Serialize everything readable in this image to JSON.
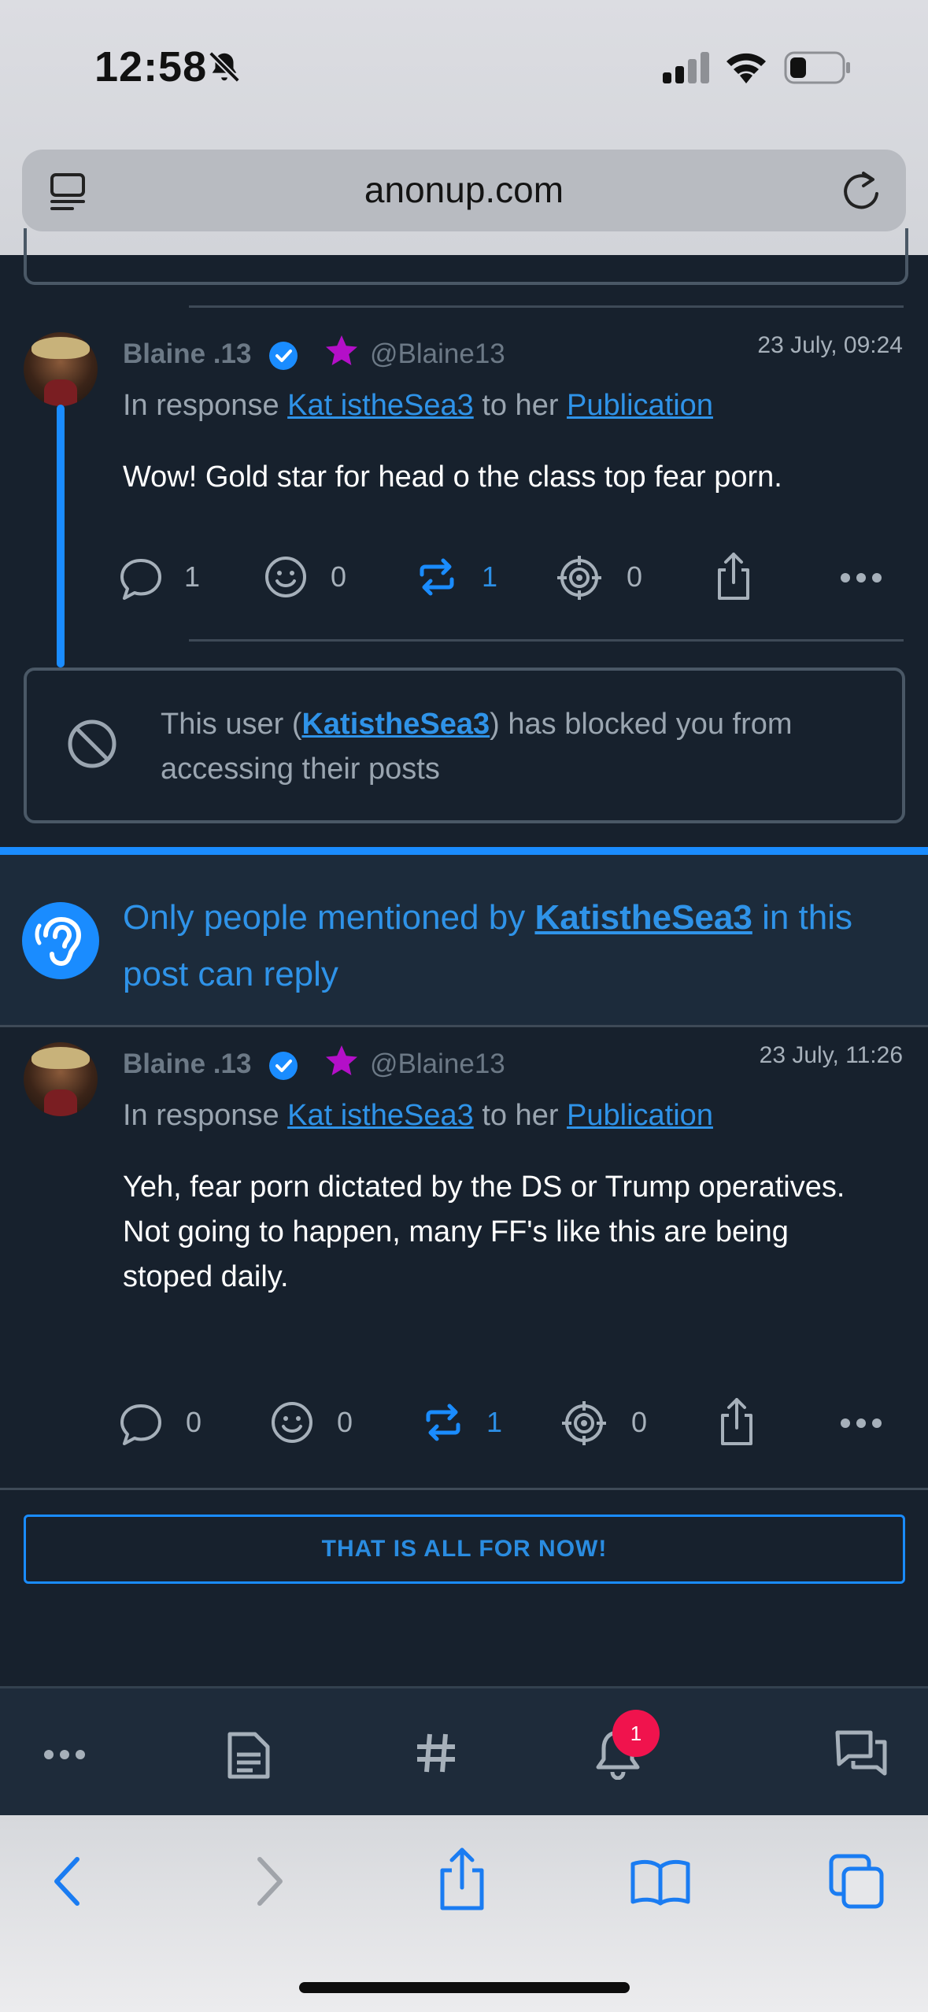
{
  "status_bar": {
    "time": "12:58"
  },
  "browser": {
    "url": "anonup.com"
  },
  "posts": [
    {
      "author": "Blaine .13",
      "handle": "@Blaine13",
      "timestamp": "23 July, 09:24",
      "response_prefix": "In response",
      "response_user": "Kat istheSea3",
      "response_mid": "to her",
      "response_link": "Publication",
      "text": "Wow! Gold star for head o the class top fear porn.",
      "counts": {
        "replies": "1",
        "reactions": "0",
        "reposts": "1",
        "targets": "0"
      }
    },
    {
      "author": "Blaine .13",
      "handle": "@Blaine13",
      "timestamp": "23 July, 11:26",
      "response_prefix": "In response",
      "response_user": "Kat istheSea3",
      "response_mid": "to her",
      "response_link": "Publication",
      "text_line1": "Yeh, fear porn dictated by the DS or Trump operatives.",
      "text_line2": "Not going to happen, many FF's like this are being stoped daily.",
      "counts": {
        "replies": "0",
        "reactions": "0",
        "reposts": "1",
        "targets": "0"
      }
    }
  ],
  "blocked_notice": {
    "prefix": "This user (",
    "user": "KatistheSea3",
    "suffix": ") has blocked you from accessing their posts"
  },
  "reply_restriction": {
    "prefix": "Only people mentioned by",
    "user": "KatistheSea3",
    "suffix": "in this post can reply"
  },
  "end_button": "THAT IS ALL FOR NOW!",
  "app_nav": {
    "notifications_badge": "1"
  },
  "colors": {
    "accent": "#1a8cff",
    "background": "#17212d",
    "badge": "#f0134d",
    "star": "#b40fc8"
  }
}
